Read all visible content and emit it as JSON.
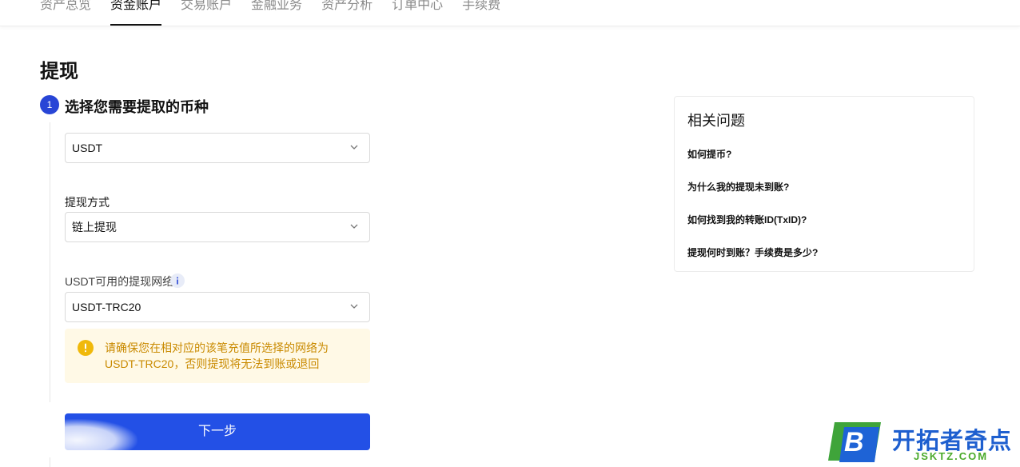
{
  "nav": {
    "tabs": [
      "资产总览",
      "资金账户",
      "交易账户",
      "金融业务",
      "资产分析",
      "订单中心",
      "手续费"
    ],
    "active_index": 1
  },
  "page": {
    "title": "提现"
  },
  "step1": {
    "number": "1",
    "title": "选择您需要提取的币种",
    "coin_value": "USDT",
    "method_label": "提现方式",
    "method_value": "链上提现",
    "network_label": "USDT可用的提现网络",
    "network_value": "USDT-TRC20",
    "warning_text": "请确保您在相对应的该笔充值所选择的网络为USDT-TRC20，否则提现将无法到账或退回",
    "next_label": "下一步"
  },
  "faq": {
    "title": "相关问题",
    "items": [
      "如何提币?",
      "为什么我的提现未到账?",
      "如何找到我的转账ID(TxID)?",
      "提现何时到账？手续费是多少?"
    ]
  },
  "watermark": {
    "brand": "开拓者奇点",
    "domain": "JSKTZ.COM",
    "letter": "B"
  },
  "colors": {
    "primary": "#2350e6",
    "step_badge": "#2845d6",
    "warning_bg": "#fff9e6",
    "warning_text": "#c98a00",
    "warning_icon": "#f0b90b"
  }
}
